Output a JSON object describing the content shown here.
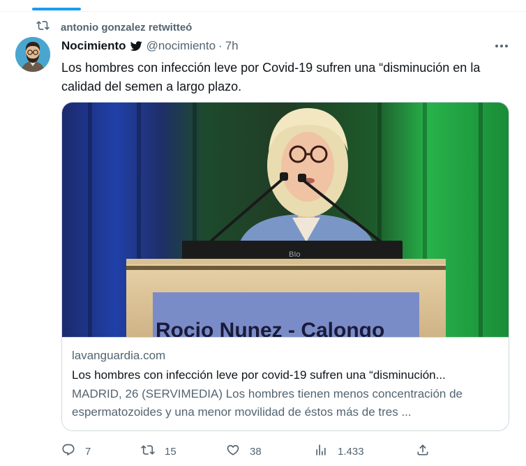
{
  "retweet_context": {
    "text": "antonio gonzalez retwitteó",
    "icon": "retweet-icon"
  },
  "tweet": {
    "author": {
      "display_name": "Nocimiento",
      "handle": "@nocimiento",
      "avatar": "cartoon-bearded-man-avatar",
      "badge_icon": "bird-icon"
    },
    "separator": "·",
    "time": "7h",
    "text": "Los hombres con infección leve por Covid-19 sufren una “disminución en la calidad del semen a largo plazo.",
    "more_icon": "more-icon"
  },
  "card": {
    "image_caption_text": "Rocio Nunez - Calongo",
    "laptop_label": "BIo",
    "domain": "lavanguardia.com",
    "title": "Los hombres con infección leve por covid-19 sufren una “disminución...",
    "description": "MADRID, 26 (SERVIMEDIA) Los hombres tienen menos concentración de espermatozoides y una menor movilidad de éstos más de tres ..."
  },
  "actions": {
    "reply": {
      "icon": "reply-icon",
      "count": "7"
    },
    "retweet": {
      "icon": "retweet-icon",
      "count": "15"
    },
    "like": {
      "icon": "heart-icon",
      "count": "38"
    },
    "views": {
      "icon": "views-icon",
      "count": "1.433"
    },
    "share": {
      "icon": "share-icon"
    }
  },
  "colors": {
    "accent": "#1d9bf0",
    "secondary_text": "#536471",
    "primary_text": "#0f1419",
    "border": "#cfd9de"
  }
}
